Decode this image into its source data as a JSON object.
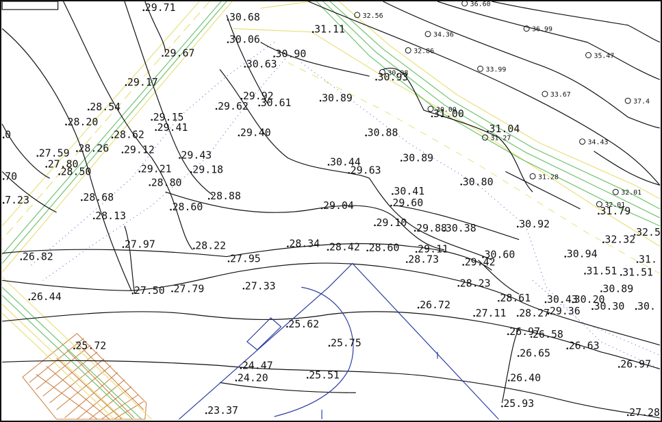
{
  "map": {
    "elevations": [
      "29.71",
      "30.68",
      "31.11",
      "30.06",
      "29.67",
      "30.90",
      "30.63",
      "30.93",
      "29.17",
      "29.92",
      "30.61",
      "30.89",
      "29.62",
      "28.54",
      "29.15",
      "31.00",
      "28.20",
      "29.41",
      "31.04",
      "28.62",
      "29.40",
      "30.88",
      "27.59",
      "28.26",
      "29.12",
      "29.43",
      "30.89",
      "27.80",
      "28.50",
      "29.21",
      "29.18",
      "30.44",
      "29.63",
      "70",
      "28.80",
      "30.80",
      "30.41",
      "7.23",
      "28.68",
      "28.88",
      "29.60",
      "28.60",
      "29.04",
      "31.79",
      "28.13",
      "29.10",
      "29.88",
      "30.38",
      "30.92",
      "32.5",
      "27.97",
      "28.22",
      "28.34",
      "28.42",
      "28.60",
      "29.11",
      "32.32",
      "26.82",
      "27.95",
      "28.73",
      "29.42",
      "30.60",
      "30.94",
      "31.51",
      "31.51",
      "31.",
      "27.33",
      "28.23",
      "30.89",
      "27.50",
      "27.79",
      "26.44",
      "26.72",
      "28.61",
      "30.43",
      "30.20",
      "30.30",
      "30.",
      "27.11",
      "28.27",
      "29.36",
      "25.62",
      "25.75",
      "26.97",
      "26.58",
      "26.63",
      "25.72",
      "26.65",
      "26.97",
      "24.47",
      "24.20",
      "25.51",
      "26.40",
      "25.93",
      "23.37",
      "27.28",
      "0"
    ],
    "benchmarks": [
      "32.56",
      "36.60",
      "34.36",
      "36.99",
      "32.86",
      "35.47",
      "30.98",
      "33.99",
      "33.67",
      "37.4",
      "30.00",
      "31.27",
      "34.43",
      "31.28",
      "32.01",
      "32.01"
    ],
    "colors": {
      "contour": "#111111",
      "road_yellow": "#e8e07a",
      "road_green": "#6cc36c",
      "building_blue": "#2a3c9f",
      "dotted_blue": "#5a6ccf",
      "hatch_orange": "#c97a3a",
      "border": "#111111"
    }
  }
}
